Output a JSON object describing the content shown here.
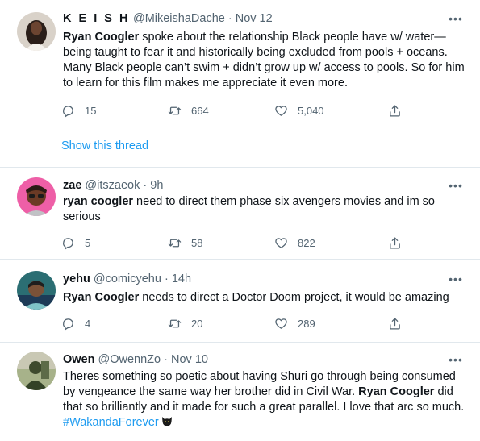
{
  "tweets": [
    {
      "name": "K E I S H",
      "handle": "@MikeishaDache",
      "separator": "·",
      "time": "Nov 12",
      "text_parts": [
        {
          "bold": true,
          "text": "Ryan Coogler"
        },
        {
          "text": " spoke about the relationship Black people have w/ water—being taught to fear it and historically being excluded from pools + oceans. Many Black people can’t swim + didn’t grow up w/ access to pools. So for him to learn for this film makes me appreciate it even more."
        }
      ],
      "replies": "15",
      "retweets": "664",
      "likes": "5,040",
      "show_thread": "Show this thread"
    },
    {
      "name": "zae",
      "handle": "@itszaeok",
      "separator": "·",
      "time": "9h",
      "text_parts": [
        {
          "bold": true,
          "text": "ryan coogler"
        },
        {
          "text": " need to direct them phase six avengers movies and im so serious"
        }
      ],
      "replies": "5",
      "retweets": "58",
      "likes": "822"
    },
    {
      "name": "yehu",
      "handle": "@comicyehu",
      "separator": "·",
      "time": "14h",
      "text_parts": [
        {
          "bold": true,
          "text": "Ryan Coogler"
        },
        {
          "text": " needs to direct a Doctor Doom project, it would be amazing"
        }
      ],
      "replies": "4",
      "retweets": "20",
      "likes": "289"
    },
    {
      "name": "Owen",
      "handle": "@OwennZo",
      "separator": "·",
      "time": "Nov 10",
      "text_parts": [
        {
          "text": "Theres something so poetic about having Shuri go through being consumed by vengeance the same way her brother did in Civil War. "
        },
        {
          "bold": true,
          "text": "Ryan Coogler"
        },
        {
          "text": " did that so brilliantly and it made for such a great parallel. I love that arc so much. "
        },
        {
          "hashtag": true,
          "text": "#WakandaForever"
        }
      ]
    }
  ],
  "icons": {
    "more": "more-dots-icon",
    "reply": "reply-icon",
    "retweet": "retweet-icon",
    "like": "heart-icon",
    "share": "share-icon",
    "emoji": "black-panther-emoji"
  },
  "colors": {
    "link": "#1d9bf0",
    "muted": "#536471",
    "divider": "#e1e8ed",
    "text": "#0f1419"
  }
}
